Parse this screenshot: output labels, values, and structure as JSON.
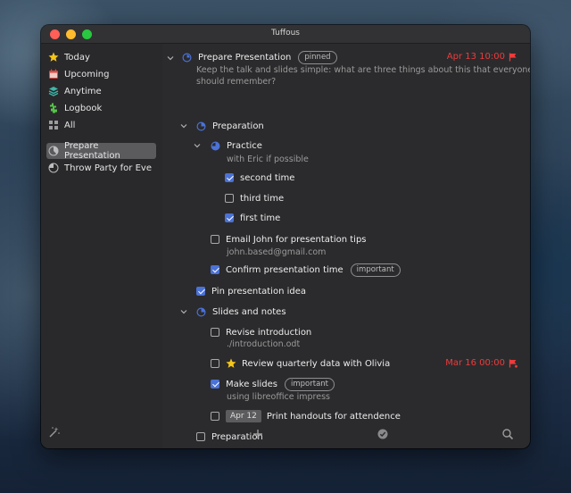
{
  "window": {
    "title": "Tuffous"
  },
  "sidebar": {
    "items": [
      {
        "label": "Today"
      },
      {
        "label": "Upcoming"
      },
      {
        "label": "Anytime"
      },
      {
        "label": "Logbook"
      },
      {
        "label": "All"
      }
    ],
    "projects": [
      {
        "label": "Prepare Presentation",
        "selected": true
      },
      {
        "label": "Throw Party for Eve",
        "selected": false
      }
    ]
  },
  "project": {
    "title": "Prepare Presentation",
    "badge": "pinned",
    "due": "Apr 13 10:00",
    "notes_line1": "Keep the talk and slides simple: what are three things about this that everyone",
    "notes_line2": "should remember?"
  },
  "tasks": {
    "preparation": {
      "title": "Preparation"
    },
    "practice": {
      "title": "Practice",
      "note": "with Eric if possible"
    },
    "second_time": {
      "title": "second time",
      "checked": true
    },
    "third_time": {
      "title": "third time",
      "checked": false
    },
    "first_time": {
      "title": "first time",
      "checked": true
    },
    "email_john": {
      "title": "Email John for presentation tips",
      "note": "john.based@gmail.com",
      "checked": false
    },
    "confirm_time": {
      "title": "Confirm presentation time",
      "tag": "important",
      "checked": true
    },
    "pin_idea": {
      "title": "Pin presentation idea",
      "checked": true
    },
    "slides": {
      "title": "Slides and notes"
    },
    "revise_intro": {
      "title": "Revise introduction",
      "note": "./introduction.odt",
      "checked": false
    },
    "review_data": {
      "title": "Review quarterly data with Olivia",
      "due": "Mar 16 00:00",
      "checked": false
    },
    "make_slides": {
      "title": "Make slides",
      "tag": "important",
      "note": "using libreoffice impress",
      "checked": true
    },
    "print_handouts": {
      "title": "Print handouts for attendence",
      "date_chip": "Apr 12",
      "checked": false
    },
    "preparation2": {
      "title": "Preparation",
      "checked": false
    }
  },
  "colors": {
    "accent": "#4b72d6",
    "due_red": "#ee3b3b",
    "star": "#f5c518",
    "today": "#f5c518",
    "upcoming": "#e0463e",
    "anytime": "#3fb6a8",
    "logbook": "#56c24a"
  },
  "icons": {
    "toolbar": [
      "magic-wand-icon",
      "plus-icon",
      "check-circle-icon",
      "search-icon"
    ]
  }
}
